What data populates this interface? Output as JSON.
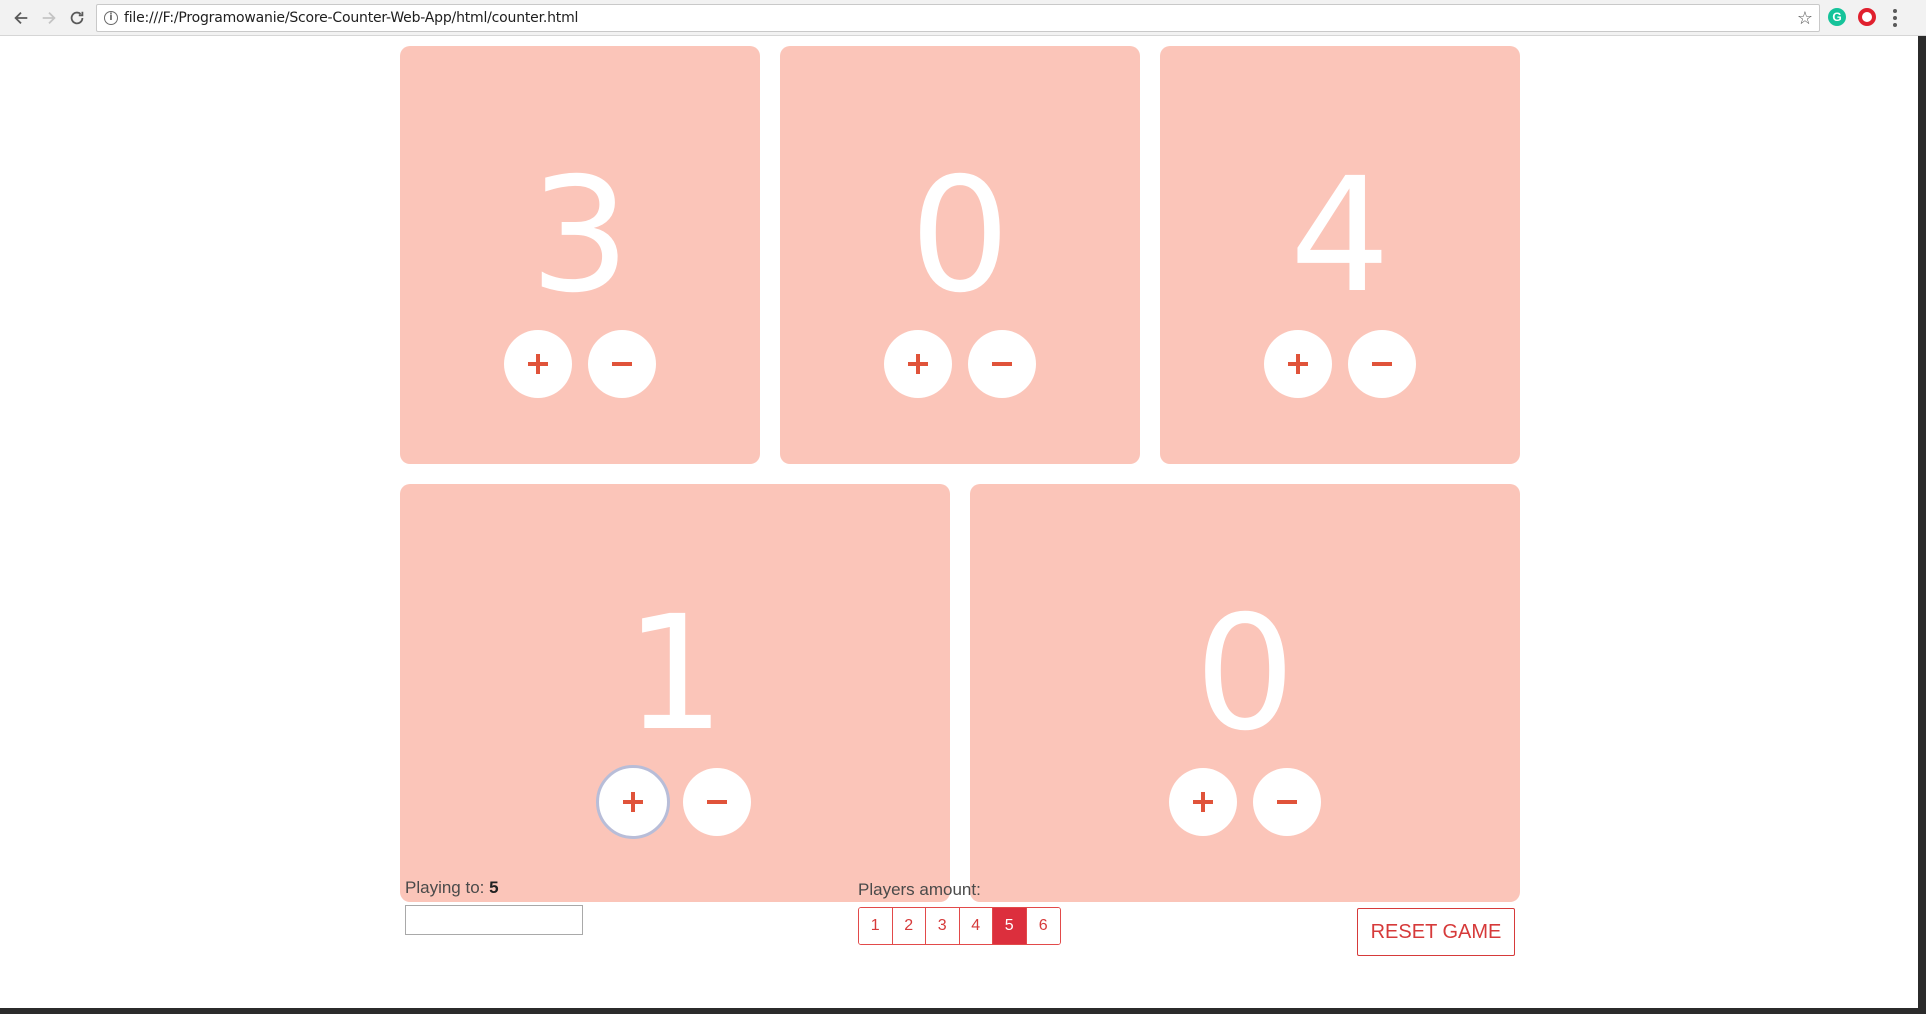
{
  "browser": {
    "url": "file:///F:/Programowanie/Score-Counter-Web-App/html/counter.html"
  },
  "players": [
    {
      "score": "3"
    },
    {
      "score": "0"
    },
    {
      "score": "4"
    },
    {
      "score": "1"
    },
    {
      "score": "0"
    }
  ],
  "controls": {
    "playing_to_label": "Playing to:",
    "playing_to_value": "5",
    "playing_to_input_value": "",
    "players_amount_label": "Players amount:",
    "player_options": [
      "1",
      "2",
      "3",
      "4",
      "5",
      "6"
    ],
    "selected_players": "5",
    "reset_label": "RESET GAME"
  },
  "colors": {
    "card": "#fbc5b9",
    "accent": "#dc2f3d",
    "icon": "#e0533a"
  }
}
